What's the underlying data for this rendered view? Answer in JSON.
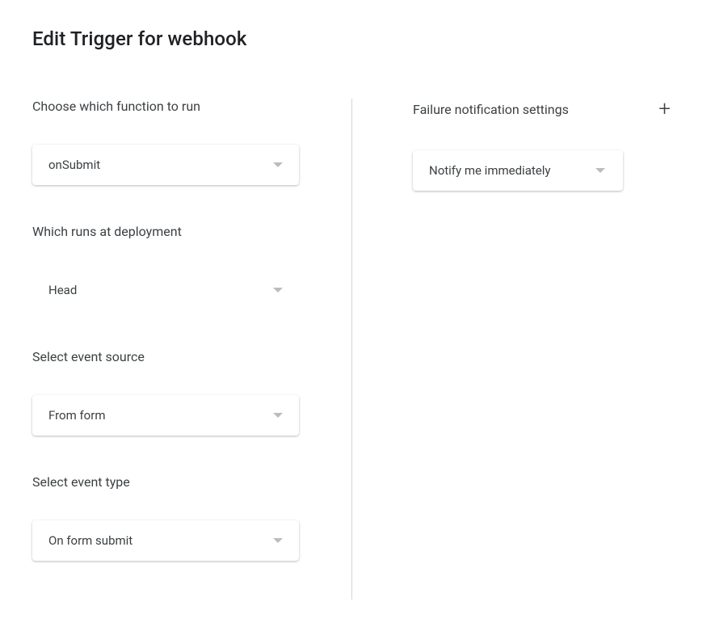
{
  "title": "Edit Trigger for webhook",
  "left": {
    "function_label": "Choose which function to run",
    "function_value": "onSubmit",
    "deployment_label": "Which runs at deployment",
    "deployment_value": "Head",
    "source_label": "Select event source",
    "source_value": "From form",
    "type_label": "Select event type",
    "type_value": "On form submit"
  },
  "right": {
    "notification_label": "Failure notification settings",
    "notification_value": "Notify me immediately"
  }
}
